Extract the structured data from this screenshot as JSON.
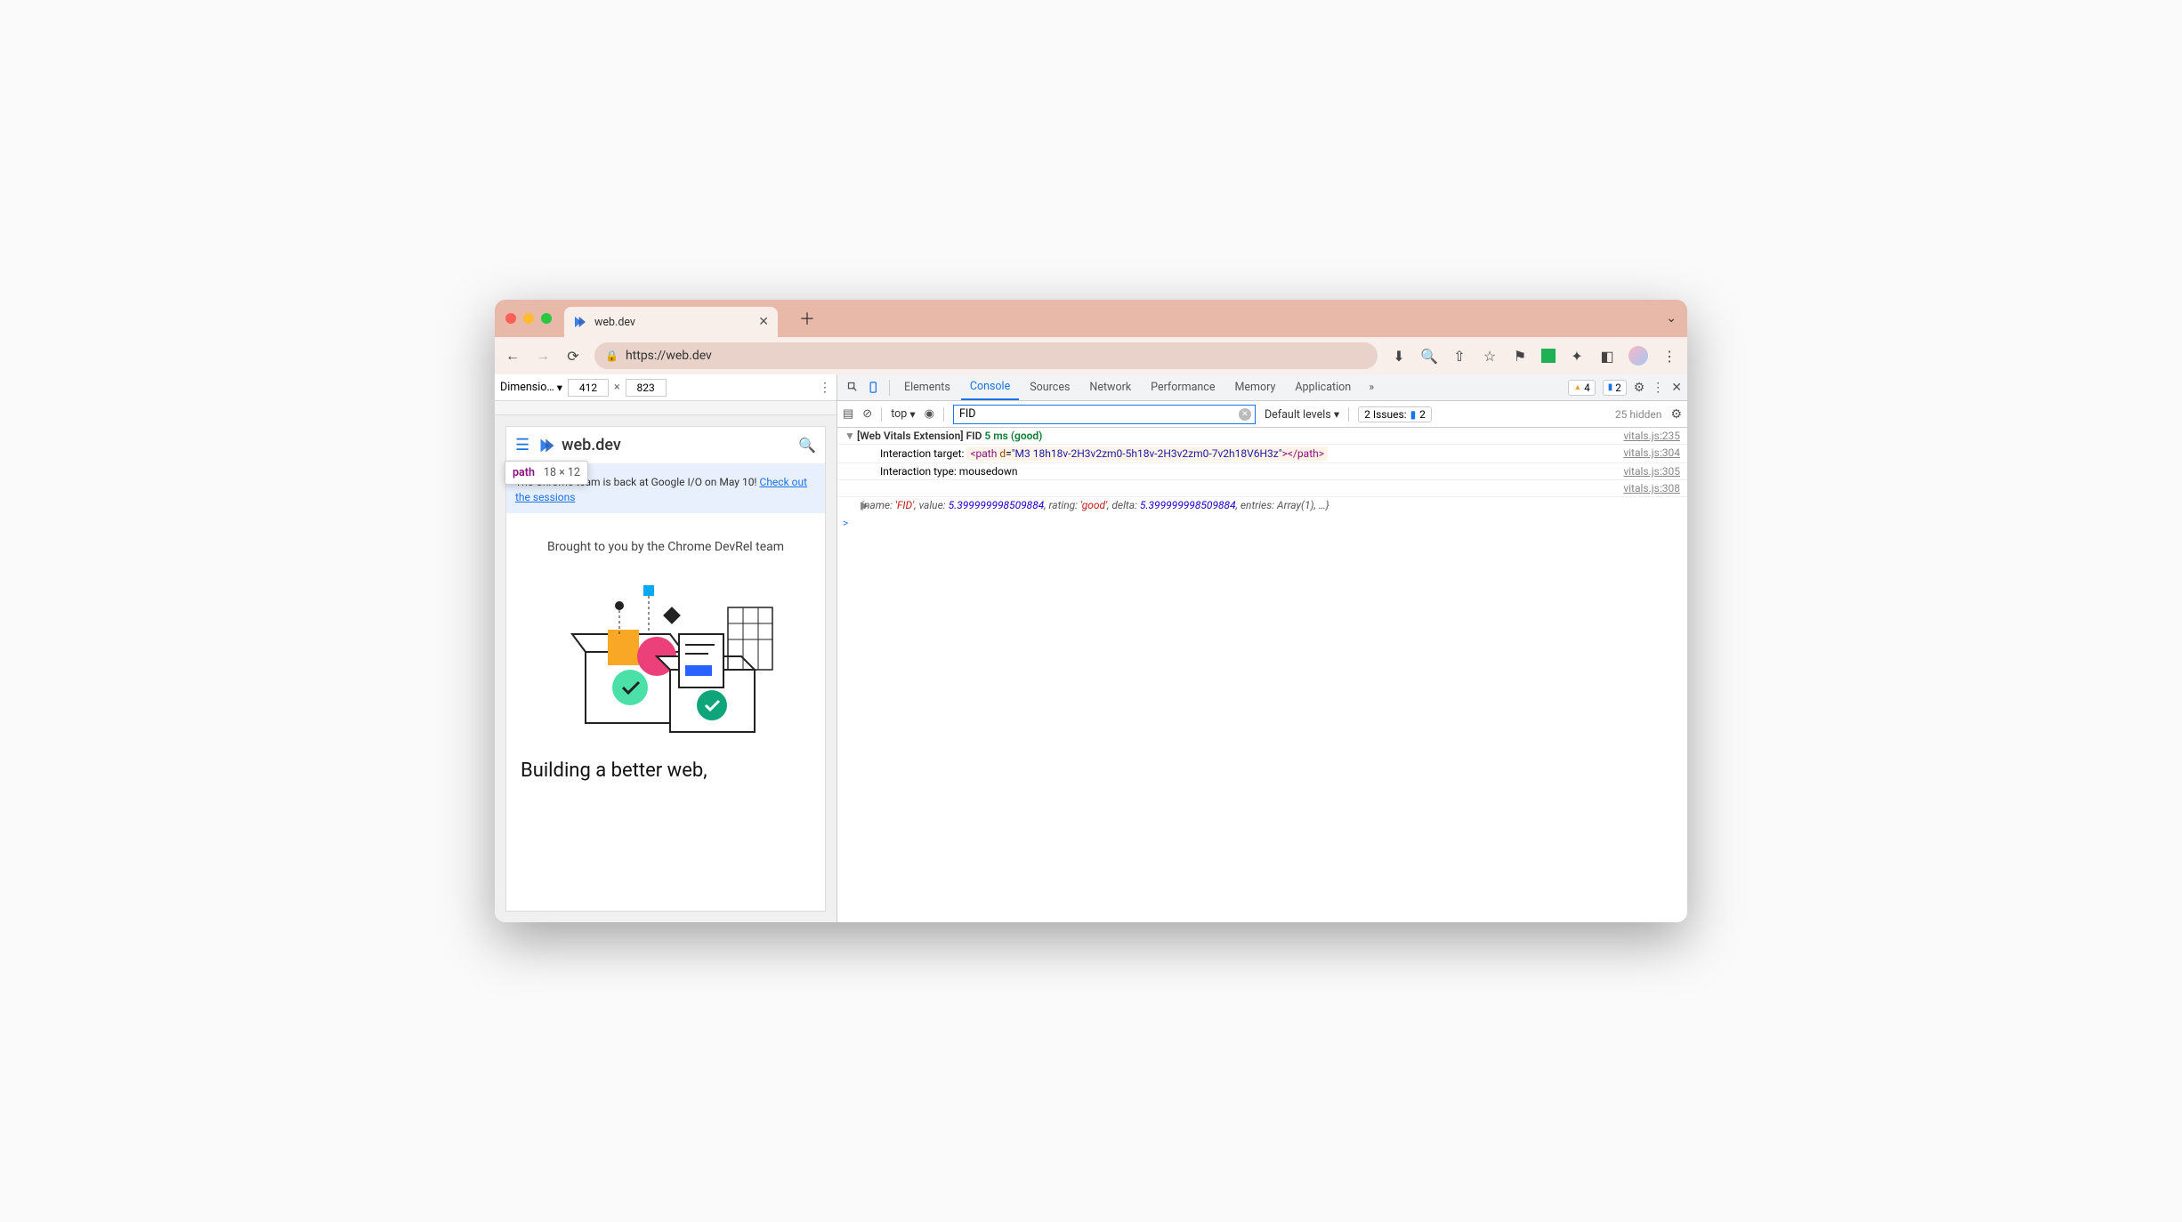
{
  "browser": {
    "tab_title": "web.dev",
    "url_display": "https://web.dev"
  },
  "device_bar": {
    "label": "Dimensio…",
    "width": "412",
    "height": "823",
    "x": "×"
  },
  "mobile": {
    "site_name": "web.dev",
    "tooltip_tag": "path",
    "tooltip_size": "18 × 12",
    "banner_text": "The Chrome team is back at Google I/O on May 10! ",
    "banner_link": "Check out the sessions",
    "brought": "Brought to you by the Chrome DevRel team",
    "headline": "Building a better web,"
  },
  "devtools": {
    "tabs": [
      "Elements",
      "Console",
      "Sources",
      "Network",
      "Performance",
      "Memory",
      "Application"
    ],
    "active_tab": "Console",
    "warn_count": "4",
    "info_count": "2",
    "context": "top",
    "filter_value": "FID",
    "levels": "Default levels",
    "issues_label": "2 Issues:",
    "issues_count": "2",
    "hidden": "25 hidden"
  },
  "console": {
    "line1_prefix": "[Web Vitals Extension] FID ",
    "line1_metric": "5 ms (good)",
    "line1_link": "vitals.js:235",
    "line2_label": "Interaction target: ",
    "line2_tag_open": "<path ",
    "line2_attr": "d",
    "line2_eq": "=",
    "line2_val": "\"M3 18h18v-2H3v2zm0-5h18v-2H3v2zm0-7v2h18V6H3z\"",
    "line2_tag_close": "></path>",
    "line2_link": "vitals.js:304",
    "line3_label": "Interaction type: ",
    "line3_val": "mousedown",
    "line3_link": "vitals.js:305",
    "line4_link": "vitals.js:308",
    "obj_open": "{",
    "obj_k1": "name: ",
    "obj_v1": "'FID'",
    "obj_k2": ", value: ",
    "obj_v2": "5.399999998509884",
    "obj_k3": ", rating: ",
    "obj_v3": "'good'",
    "obj_k4": ", delta: ",
    "obj_v4": "5.399999998509884",
    "obj_k5": ", entries: ",
    "obj_v5": "Array(1)",
    "obj_rest": ", …}",
    "prompt": ">"
  }
}
